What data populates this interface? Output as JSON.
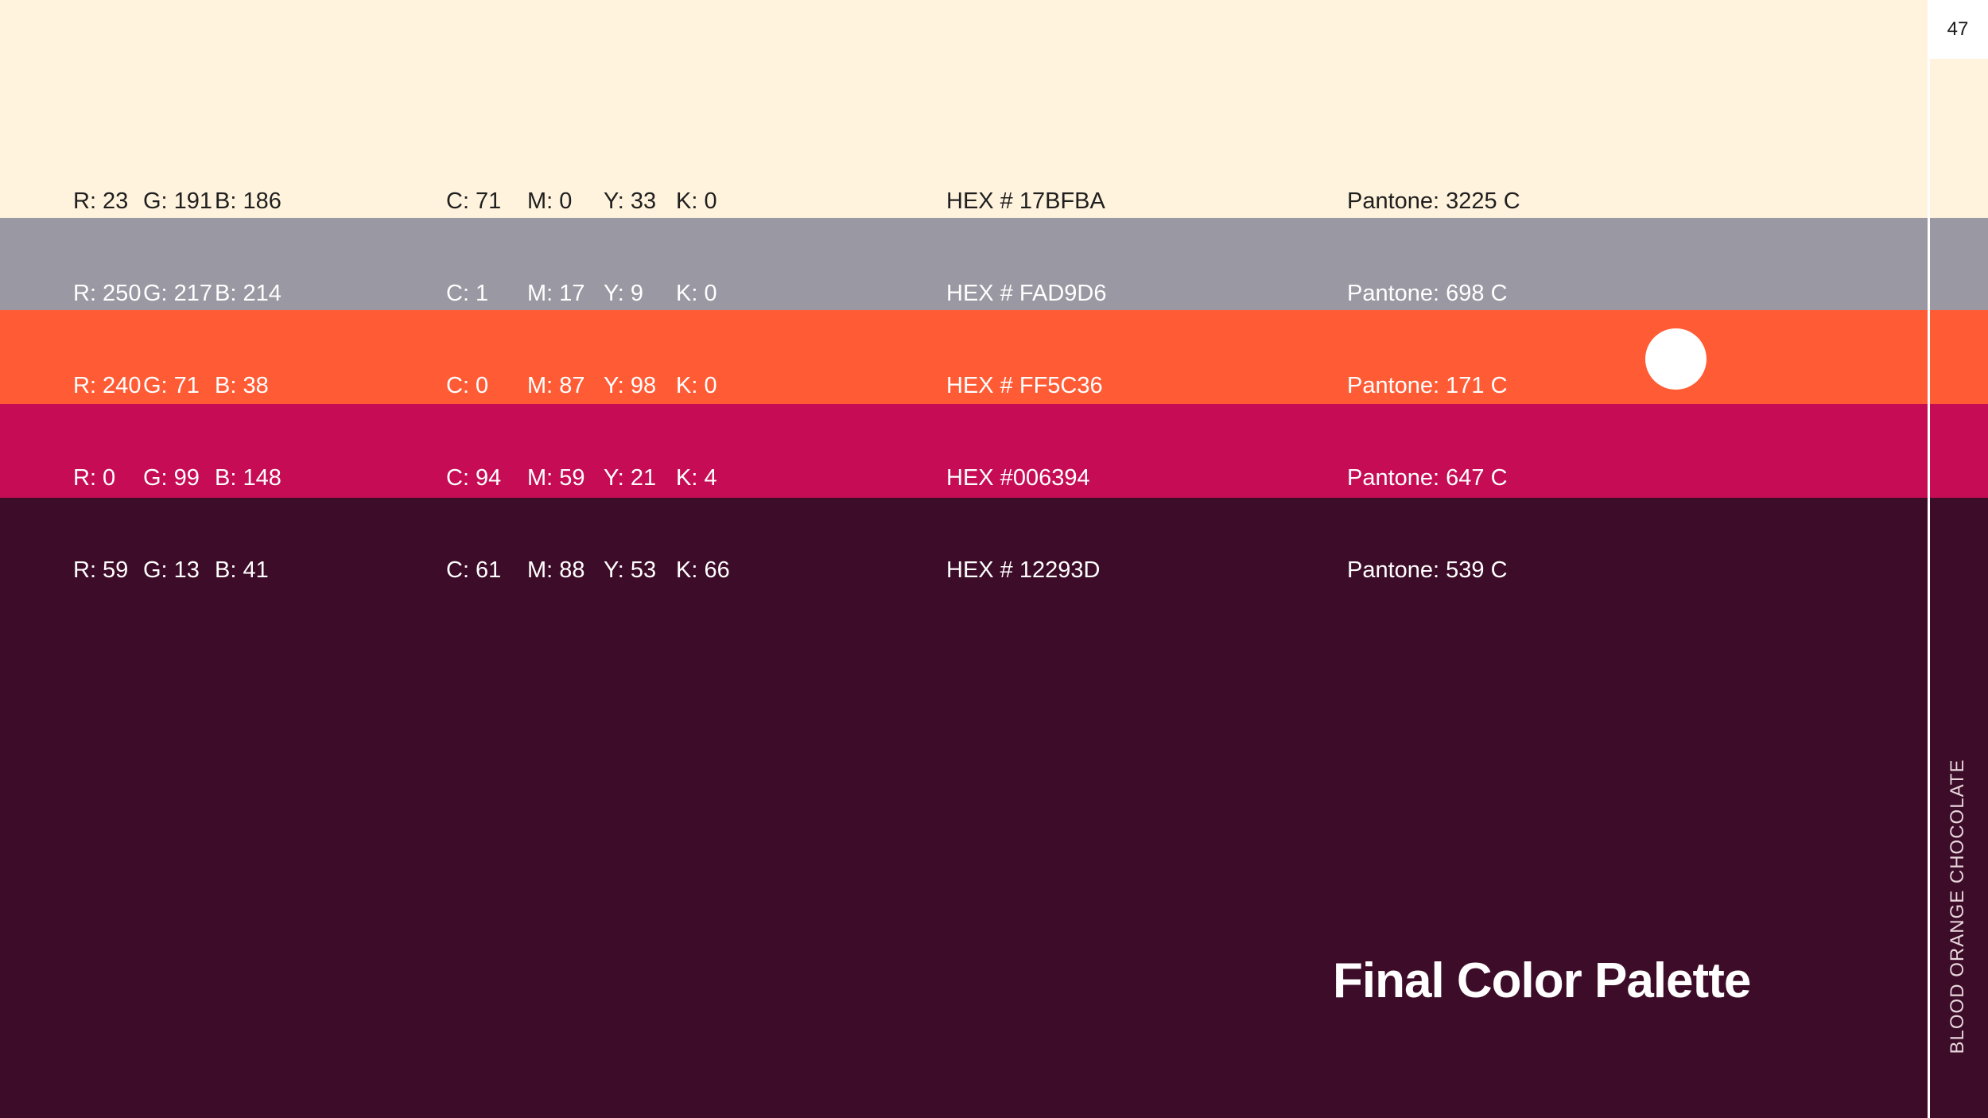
{
  "page_number": "47",
  "vertical_label": "BLOOD ORANGE CHOCOLATE",
  "title": "Final Color Palette",
  "swatches": [
    {
      "fill": "#FFF3DD",
      "text_color": "#1f1f1f",
      "rgb": {
        "r": "R: 23",
        "g": "G: 191",
        "b": "B: 186"
      },
      "cmyk": {
        "c": "C: 71",
        "m": "M: 0",
        "y": "Y: 33",
        "k": "K: 0"
      },
      "hex": "HEX # 17BFBA",
      "pantone": "Pantone: 3225 C"
    },
    {
      "fill": "#9A98A2",
      "text_color": "#ffffff",
      "rgb": {
        "r": "R: 250",
        "g": "G: 217",
        "b": "B: 214"
      },
      "cmyk": {
        "c": "C: 1",
        "m": "M: 17",
        "y": "Y: 9",
        "k": "K: 0"
      },
      "hex": "HEX # FAD9D6",
      "pantone": "Pantone: 698 C"
    },
    {
      "fill": "#FF5C36",
      "text_color": "#ffffff",
      "rgb": {
        "r": "R: 240",
        "g": "G: 71",
        "b": "B: 38"
      },
      "cmyk": {
        "c": "C: 0",
        "m": "M: 87",
        "y": "Y: 98",
        "k": "K: 0"
      },
      "hex": "HEX # FF5C36",
      "pantone": "Pantone: 171 C"
    },
    {
      "fill": "#C50C55",
      "text_color": "#ffffff",
      "rgb": {
        "r": "R: 0",
        "g": "G: 99",
        "b": "B: 148"
      },
      "cmyk": {
        "c": "C: 94",
        "m": "M: 59",
        "y": "Y: 21",
        "k": "K: 4"
      },
      "hex": "HEX #006394",
      "pantone": "Pantone: 647 C"
    },
    {
      "fill": "#3D0C28",
      "text_color": "#ffffff",
      "rgb": {
        "r": "R: 59",
        "g": "G: 13",
        "b": "B: 41"
      },
      "cmyk": {
        "c": "C: 61",
        "m": "M: 88",
        "y": "Y: 53",
        "k": "K: 66"
      },
      "hex": "HEX # 12293D",
      "pantone": "Pantone: 539 C"
    }
  ]
}
